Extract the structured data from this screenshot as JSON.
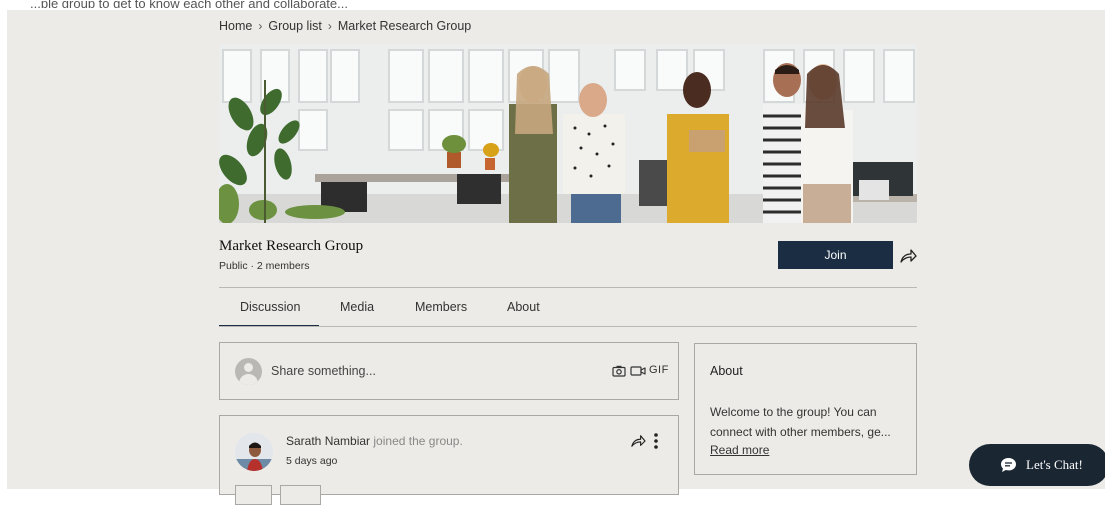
{
  "top_bleed_text": "...ple group to get to know each other and collaborate...",
  "breadcrumb": {
    "items": [
      "Home",
      "Group list",
      "Market Research Group"
    ]
  },
  "group": {
    "title": "Market Research Group",
    "meta": "Public · 2 members",
    "join_label": "Join"
  },
  "tabs": [
    {
      "label": "Discussion",
      "active": true
    },
    {
      "label": "Media"
    },
    {
      "label": "Members"
    },
    {
      "label": "About"
    }
  ],
  "composer": {
    "placeholder": "Share something...",
    "gif_label": "GIF"
  },
  "about": {
    "title": "About",
    "text": "Welcome to the group! You can connect with other members, ge...",
    "read_more": "Read more"
  },
  "post": {
    "author": "Sarath Nambiar",
    "action": "joined the group.",
    "time": "5 days ago"
  },
  "chat": {
    "label": "Let's Chat!"
  },
  "colors": {
    "accent": "#1a2d42",
    "page_background": "#ecebe7",
    "chat_background": "#1a2733"
  },
  "icons": [
    "share-icon",
    "camera-icon",
    "video-icon",
    "more-icon",
    "chat-bubble-icon",
    "avatar-placeholder-icon"
  ]
}
